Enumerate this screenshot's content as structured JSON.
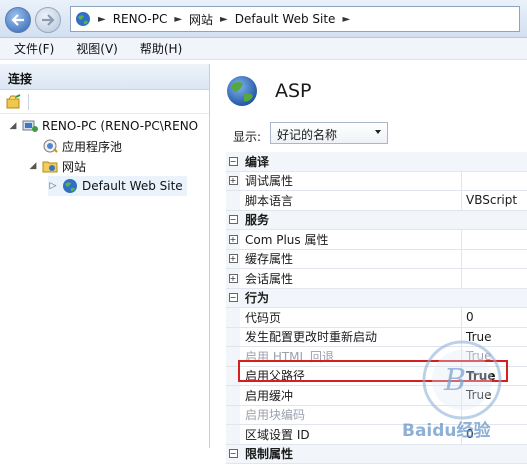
{
  "address_bar": {
    "crumbs": [
      "RENO-PC",
      "网站",
      "Default Web Site"
    ]
  },
  "menu": {
    "items": [
      "文件(F)",
      "视图(V)",
      "帮助(H)"
    ]
  },
  "connections": {
    "header": "连接",
    "tree": [
      {
        "label": "RENO-PC (RENO-PC\\RENO",
        "icon": "server-icon"
      },
      {
        "label": "应用程序池",
        "icon": "app-pool-icon"
      },
      {
        "label": "网站",
        "icon": "folder-icon"
      },
      {
        "label": "Default Web Site",
        "icon": "globe-icon",
        "selected": true
      }
    ]
  },
  "page": {
    "title": "ASP",
    "display_label": "显示:",
    "display_value": "好记的名称"
  },
  "grid": {
    "rows": [
      {
        "type": "category",
        "name": "编译",
        "value": ""
      },
      {
        "type": "group",
        "name": "调试属性",
        "value": ""
      },
      {
        "type": "prop",
        "name": "脚本语言",
        "value": "VBScript"
      },
      {
        "type": "category",
        "name": "服务",
        "value": ""
      },
      {
        "type": "group",
        "name": "Com Plus 属性",
        "value": ""
      },
      {
        "type": "group",
        "name": "缓存属性",
        "value": ""
      },
      {
        "type": "group",
        "name": "会话属性",
        "value": ""
      },
      {
        "type": "category",
        "name": "行为",
        "value": ""
      },
      {
        "type": "prop",
        "name": "代码页",
        "value": "0"
      },
      {
        "type": "prop",
        "name": "发生配置更改时重新启动",
        "value": "True"
      },
      {
        "type": "prop",
        "name": "启用 HTML 回退",
        "value": "True",
        "disabled": true
      },
      {
        "type": "prop",
        "name": "启用父路径",
        "value": "True",
        "highlighted": true
      },
      {
        "type": "prop",
        "name": "启用缓冲",
        "value": "True"
      },
      {
        "type": "prop",
        "name": "启用块编码",
        "value": "",
        "disabled": true
      },
      {
        "type": "prop",
        "name": "区域设置 ID",
        "value": "0"
      },
      {
        "type": "category",
        "name": "限制属性",
        "value": ""
      }
    ]
  },
  "watermark": {
    "text": "Bai du 经验"
  },
  "colors": {
    "highlight_border": "#d42020",
    "selection": "#eaf2fb"
  }
}
